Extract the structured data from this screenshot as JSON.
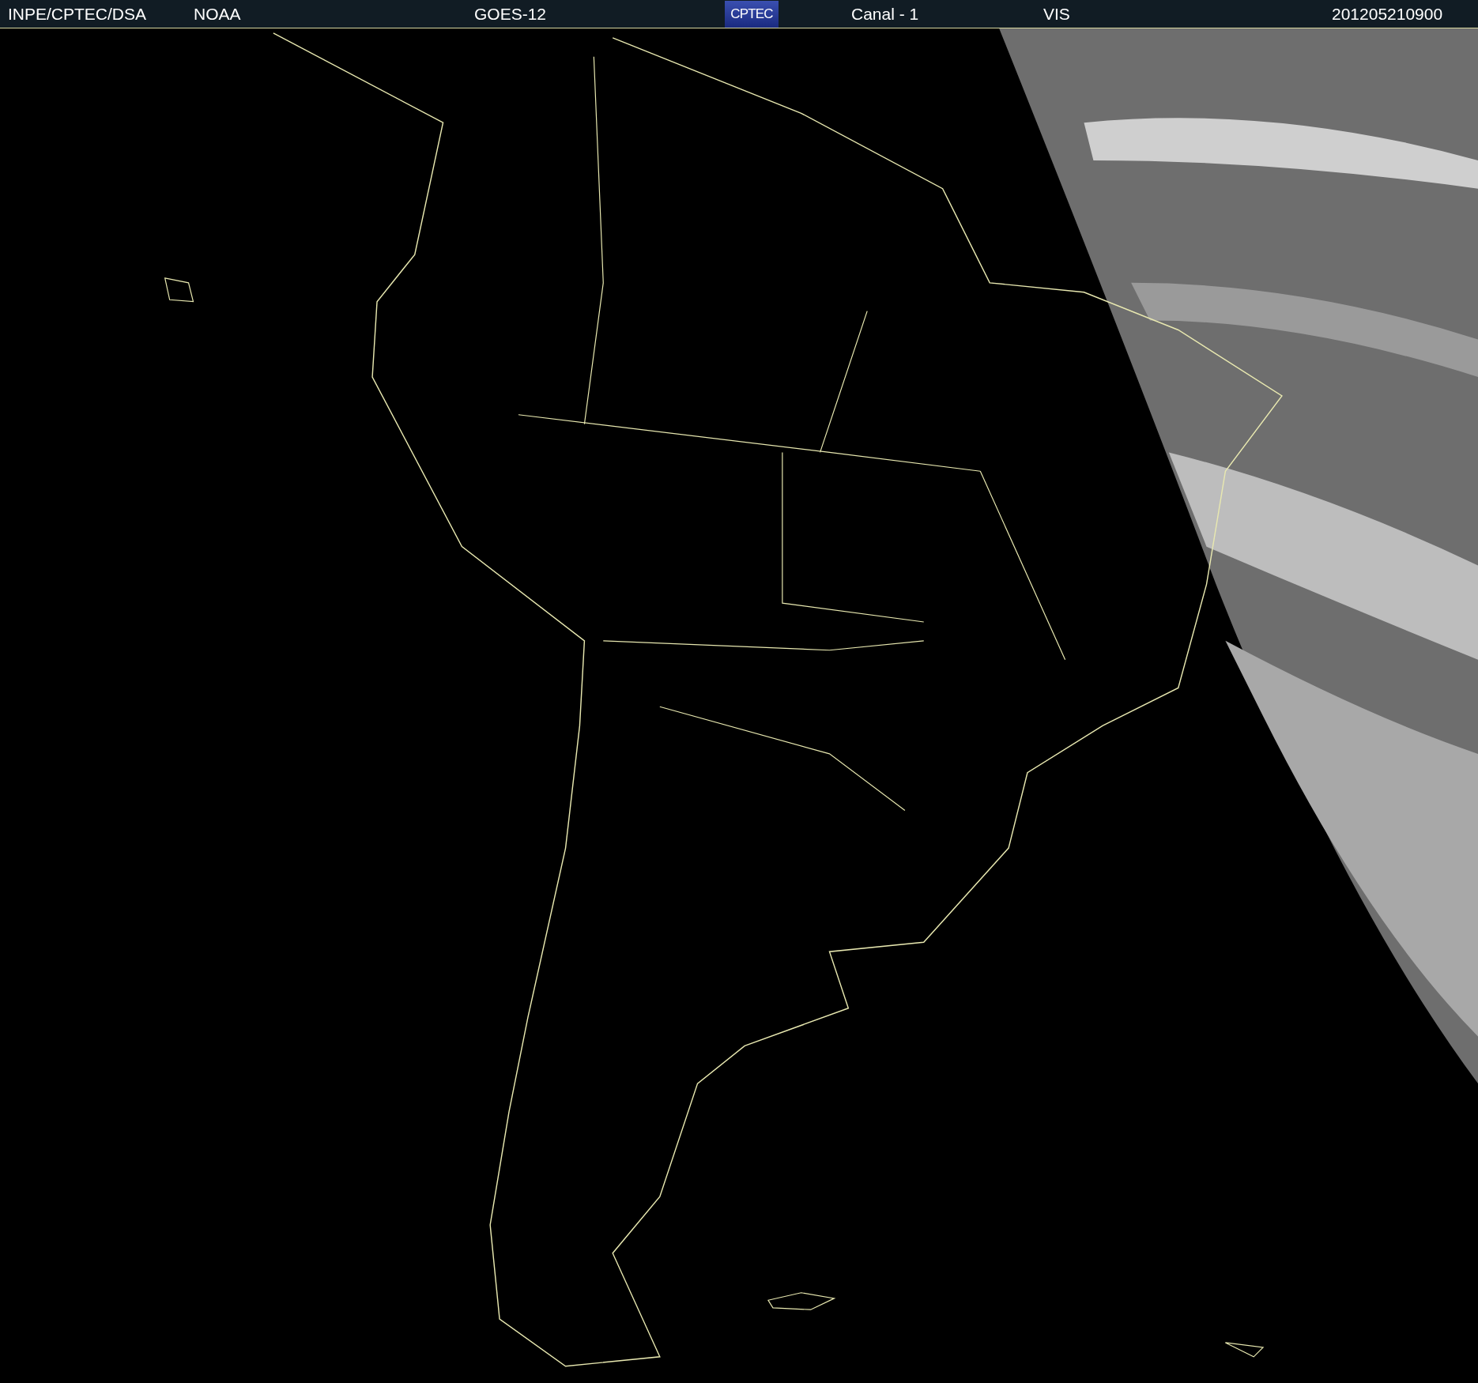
{
  "header": {
    "source": "INPE/CPTEC/DSA",
    "agency": "NOAA",
    "satellite": "GOES-12",
    "logo": "CPTEC",
    "channel": "Canal - 1",
    "band": "VIS",
    "timestamp": "201205210900"
  }
}
